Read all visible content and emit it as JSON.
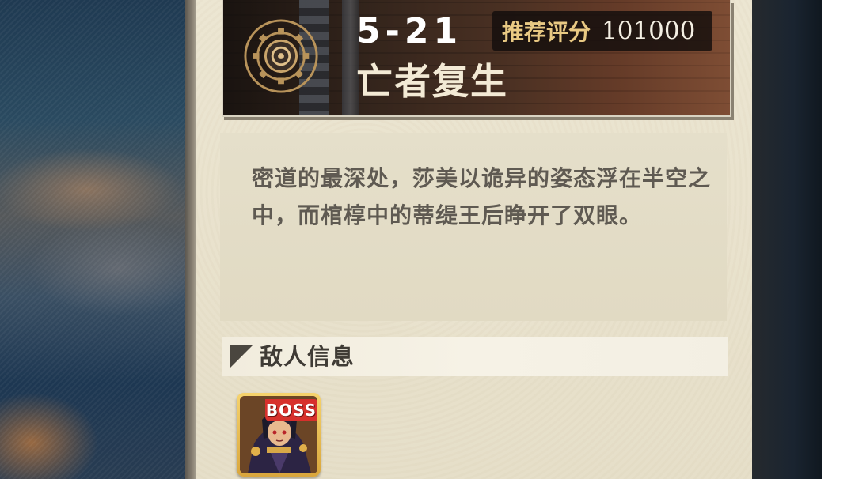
{
  "stage": {
    "number": "5-21",
    "name": "亡者复生",
    "recommended_score_label": "推荐评分",
    "recommended_score_value": "101000"
  },
  "description": "密道的最深处，莎美以诡异的姿态浮在半空之中，而棺椁中的蒂缇王后睁开了双眼。",
  "enemy_section": {
    "title": "敌人信息",
    "enemies": [
      {
        "tag": "BOSS",
        "portrait_icon": "boss-portrait-icon"
      }
    ]
  },
  "colors": {
    "parchment": "#e9e2cd",
    "score_label": "#e9c983",
    "boss_tag": "#d7302c",
    "card_border": "#f6d36d"
  }
}
